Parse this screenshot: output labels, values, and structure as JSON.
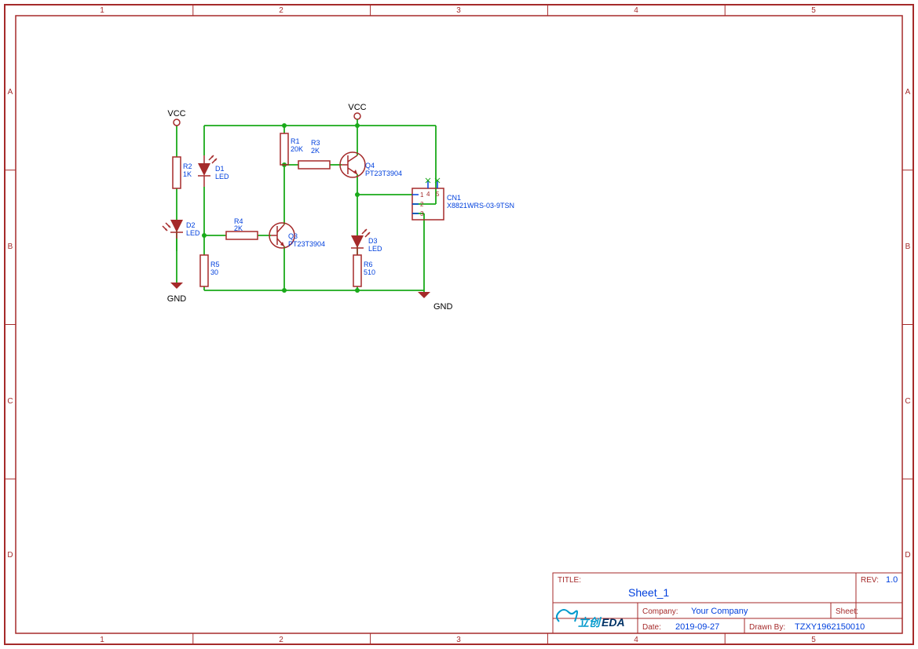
{
  "frame": {
    "cols": [
      "1",
      "2",
      "3",
      "4",
      "5"
    ],
    "rows": [
      "A",
      "B",
      "C",
      "D"
    ]
  },
  "power": {
    "vcc1": "VCC",
    "vcc2": "VCC",
    "gnd1": "GND",
    "gnd2": "GND"
  },
  "components": {
    "R1": {
      "ref": "R1",
      "value": "20K"
    },
    "R2": {
      "ref": "R2",
      "value": "1K"
    },
    "R3": {
      "ref": "R3",
      "value": "2K"
    },
    "R4": {
      "ref": "R4",
      "value": "2K"
    },
    "R5": {
      "ref": "R5",
      "value": "30"
    },
    "R6": {
      "ref": "R6",
      "value": "510"
    },
    "D1": {
      "ref": "D1",
      "value": "LED"
    },
    "D2": {
      "ref": "D2",
      "value": "LED"
    },
    "D3": {
      "ref": "D3",
      "value": "LED"
    },
    "Q3": {
      "ref": "Q3",
      "value": "PT23T3904"
    },
    "Q4": {
      "ref": "Q4",
      "value": "PT23T3904"
    },
    "CN1": {
      "ref": "CN1",
      "value": "X8821WRS-03-9TSN",
      "pins": [
        "1",
        "2",
        "3",
        "4",
        "5"
      ]
    }
  },
  "titleblock": {
    "title_label": "TITLE:",
    "title_value": "Sheet_1",
    "rev_label": "REV:",
    "rev_value": "1.0",
    "company_label": "Company:",
    "company_value": "Your Company",
    "sheet_label": "Sheet:",
    "date_label": "Date:",
    "date_value": "2019-09-27",
    "drawn_label": "Drawn By:",
    "drawn_value": "TZXY1962150010",
    "logo1": "立创",
    "logo2": "EDA"
  }
}
